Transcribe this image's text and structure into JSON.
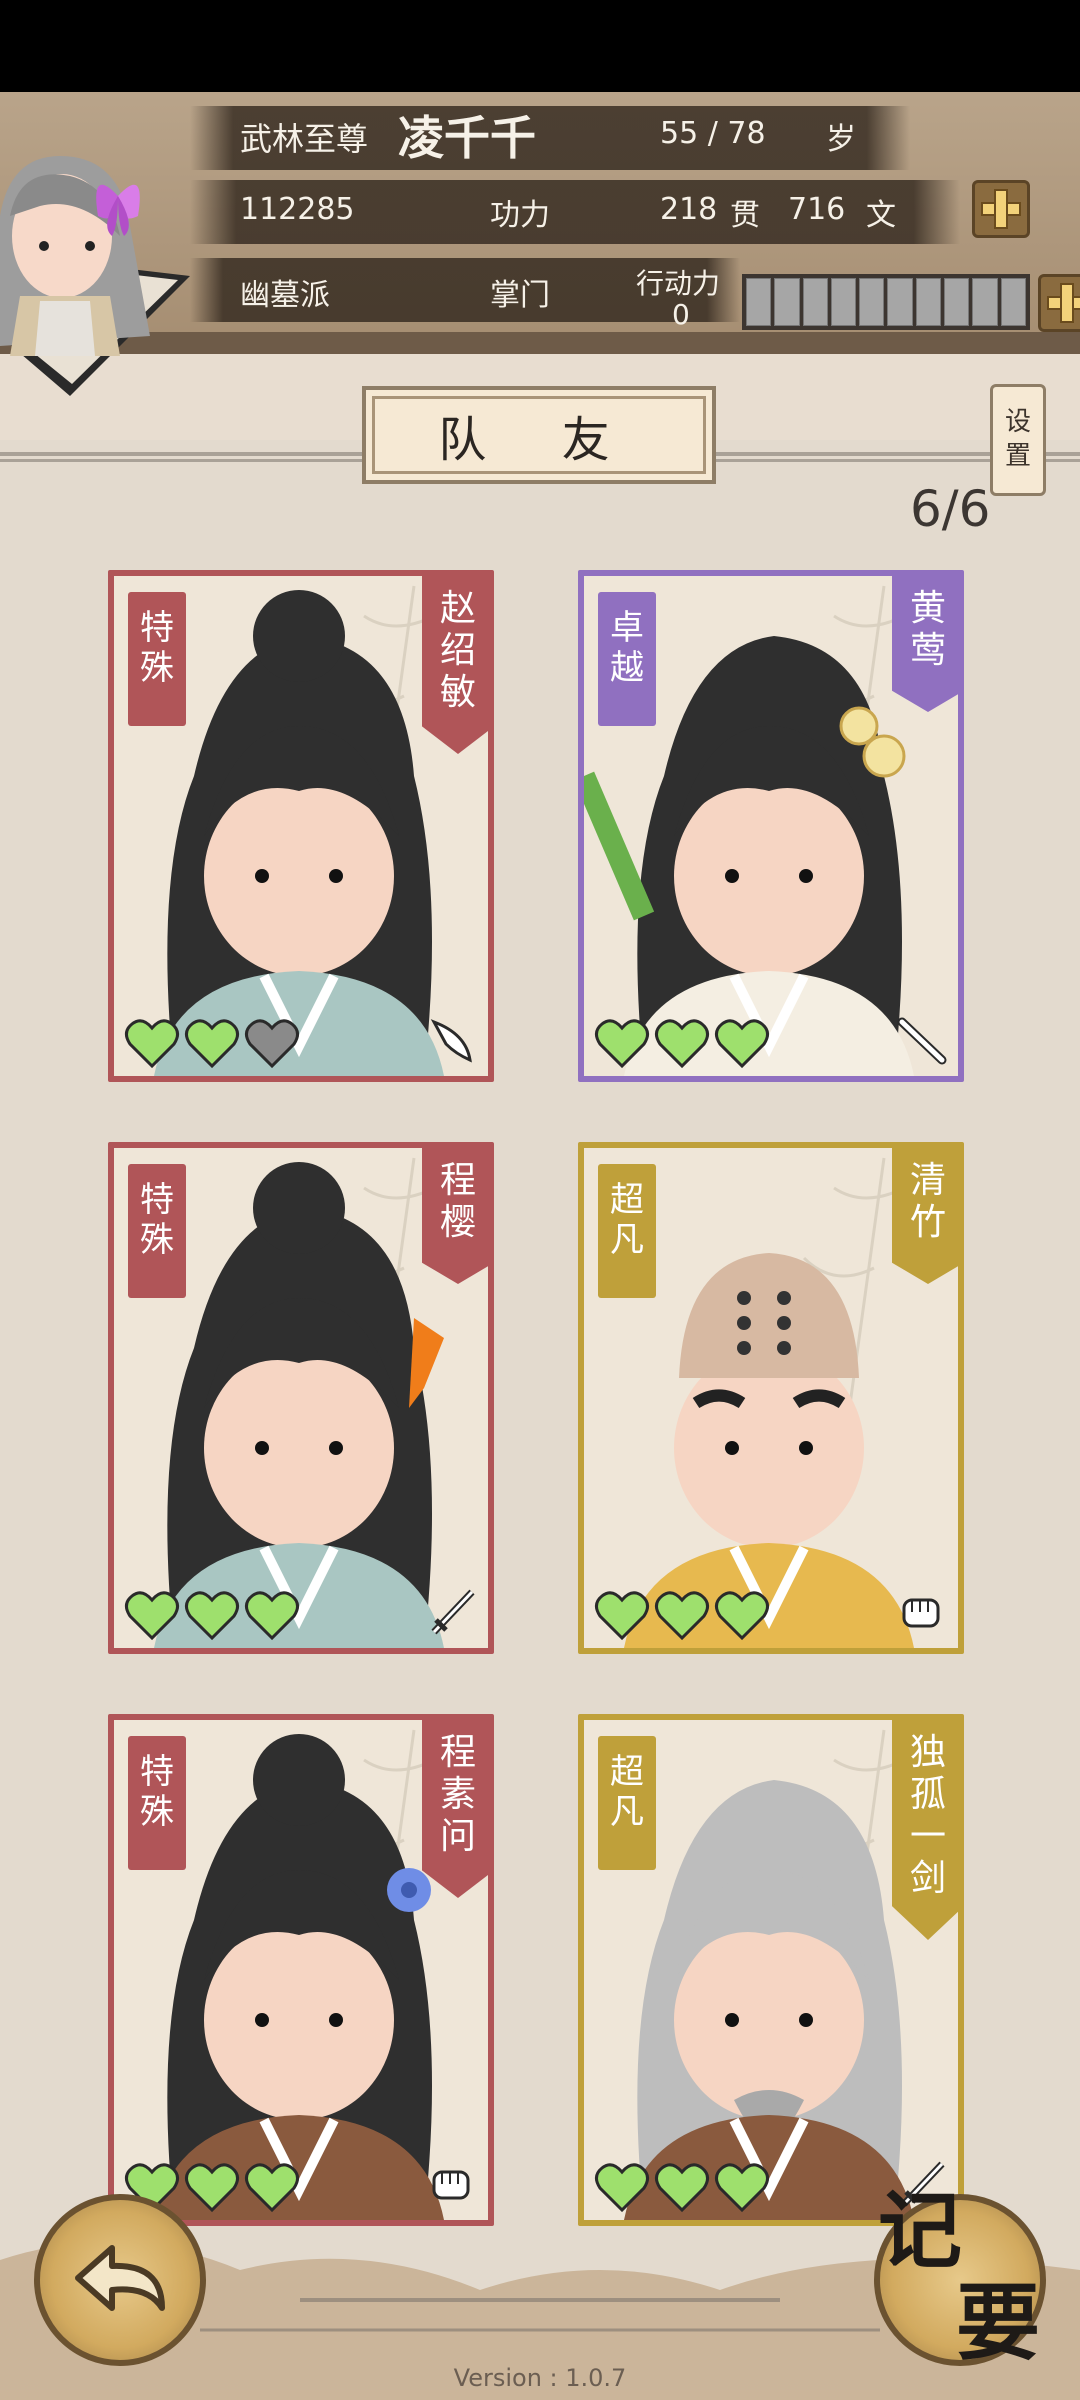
{
  "player": {
    "title": "武林至尊",
    "name": "凌千千",
    "age": "55 / 78",
    "age_unit": "岁",
    "power_value": "112285",
    "power_label": "功力",
    "money_guan": "218",
    "guan_unit": "贯",
    "money_wen": "716",
    "wen_unit": "文",
    "sect": "幽墓派",
    "rank": "掌门",
    "action_label": "行动力",
    "action_value": "0",
    "energy_segments_filled": 0,
    "energy_segments_total": 10
  },
  "screen": {
    "title": "队 友",
    "settings": "设置",
    "count": "6/6",
    "memo": "记要",
    "version": "Version : 1.0.7"
  },
  "colors": {
    "special": "#b05558",
    "zhuoyue": "#9070c0",
    "chaofan": "#bfa03a",
    "heart_full": "#9ee06d",
    "heart_empty": "#8a8a8a"
  },
  "teammates": [
    {
      "tag": "特殊",
      "name": "赵绍敏",
      "tier": "special",
      "hearts": [
        true,
        true,
        false
      ],
      "weapon": "blade-icon"
    },
    {
      "tag": "卓越",
      "name": "黄莺",
      "tier": "zhuoyue",
      "hearts": [
        true,
        true,
        true
      ],
      "weapon": "flute-icon"
    },
    {
      "tag": "特殊",
      "name": "程樱",
      "tier": "special",
      "hearts": [
        true,
        true,
        true
      ],
      "weapon": "sword-icon"
    },
    {
      "tag": "超凡",
      "name": "清竹",
      "tier": "chaofan",
      "hearts": [
        true,
        true,
        true
      ],
      "weapon": "fist-icon"
    },
    {
      "tag": "特殊",
      "name": "程素问",
      "tier": "special",
      "hearts": [
        true,
        true,
        true
      ],
      "weapon": "fist-icon"
    },
    {
      "tag": "超凡",
      "name": "独孤一剑",
      "tier": "chaofan",
      "hearts": [
        true,
        true,
        true
      ],
      "weapon": "sword-icon"
    }
  ]
}
